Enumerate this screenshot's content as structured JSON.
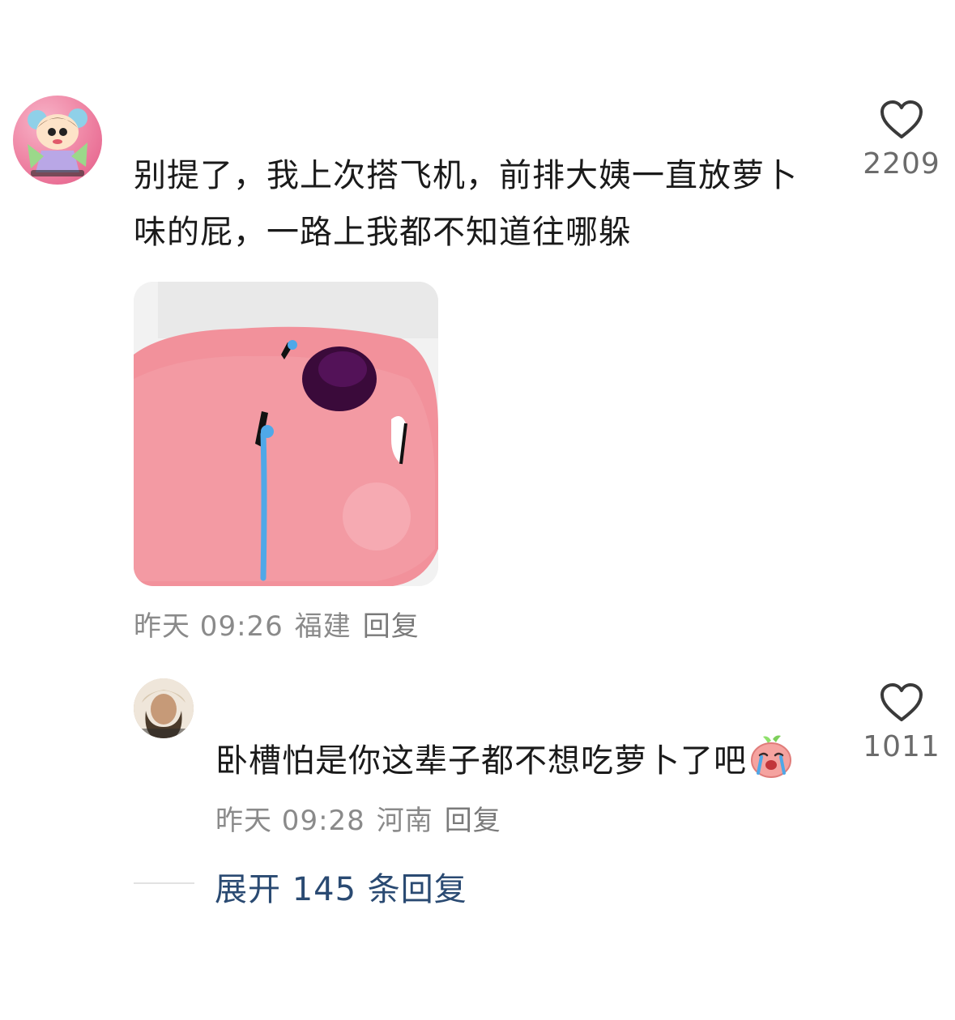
{
  "comment": {
    "text": "别提了，我上次搭飞机，前排大姨一直放萝卜味的屁，一路上我都不知道往哪躲",
    "like_count": "2209",
    "time": "昨天 09:26",
    "location": "福建",
    "reply_label": "回复",
    "avatar_icon": "cartoon-avatar-icon",
    "sticker_icon": "crying-radish-sticker"
  },
  "reply": {
    "text": "卧槽怕是你这辈子都不想吃萝卜了吧",
    "emoji_icon": "crying-radish-emoji",
    "like_count": "1011",
    "time": "昨天 09:28",
    "location": "河南",
    "reply_label": "回复",
    "avatar_icon": "photo-avatar-icon"
  },
  "expand": {
    "label": "展开 145 条回复"
  },
  "colors": {
    "text": "#1a1a1a",
    "meta": "#8a8a8a",
    "link": "#2a4a72"
  }
}
